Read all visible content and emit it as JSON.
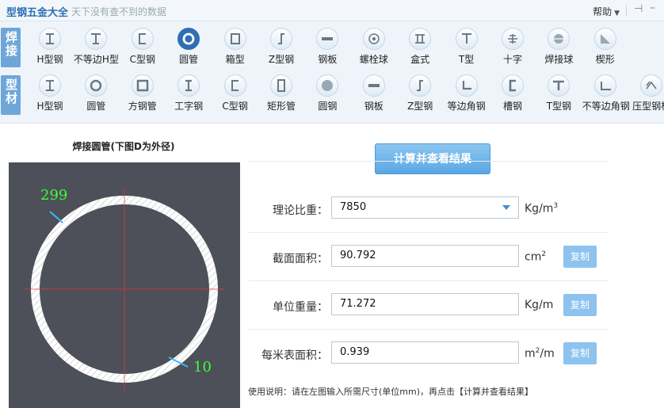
{
  "app": {
    "title": "型钢五金大全",
    "subtitle": "天下没有查不到的数据",
    "help_label": "帮助"
  },
  "row_labels": {
    "welded": "焊接",
    "profile": "型材"
  },
  "welded_tools": [
    {
      "label": "H型钢",
      "icon": "h-beam-icon"
    },
    {
      "label": "不等边H型",
      "icon": "unequal-h-beam-icon"
    },
    {
      "label": "C型钢",
      "icon": "c-channel-icon"
    },
    {
      "label": "圆管",
      "icon": "round-tube-icon"
    },
    {
      "label": "箱型",
      "icon": "box-section-icon"
    },
    {
      "label": "Z型钢",
      "icon": "z-section-icon"
    },
    {
      "label": "钢板",
      "icon": "steel-plate-icon"
    },
    {
      "label": "螺栓球",
      "icon": "bolt-ball-icon"
    },
    {
      "label": "盒式",
      "icon": "box-type-icon"
    },
    {
      "label": "T型",
      "icon": "t-section-icon"
    },
    {
      "label": "十字",
      "icon": "cross-section-icon"
    },
    {
      "label": "焊接球",
      "icon": "welded-ball-icon"
    },
    {
      "label": "楔形",
      "icon": "wedge-icon"
    }
  ],
  "profile_tools": [
    {
      "label": "H型钢",
      "icon": "h-beam-icon"
    },
    {
      "label": "圆管",
      "icon": "round-tube-icon"
    },
    {
      "label": "方钢管",
      "icon": "square-tube-icon"
    },
    {
      "label": "工字钢",
      "icon": "i-beam-icon"
    },
    {
      "label": "C型钢",
      "icon": "c-channel-icon"
    },
    {
      "label": "矩形管",
      "icon": "rect-tube-icon"
    },
    {
      "label": "圆钢",
      "icon": "round-bar-icon"
    },
    {
      "label": "钢板",
      "icon": "steel-plate-icon"
    },
    {
      "label": "Z型钢",
      "icon": "z-section-icon"
    },
    {
      "label": "等边角钢",
      "icon": "equal-angle-icon"
    },
    {
      "label": "槽钢",
      "icon": "channel-icon"
    },
    {
      "label": "T型钢",
      "icon": "t-beam-icon"
    },
    {
      "label": "不等边角钢",
      "icon": "unequal-angle-icon"
    },
    {
      "label": "压型钢板",
      "icon": "corrugated-plate-icon"
    }
  ],
  "left_panel": {
    "title": "焊接圆管(下图D为外径)",
    "outer_diameter": "299",
    "wall_thickness": "10"
  },
  "calc_button": "计算并查看结果",
  "fields": {
    "density": {
      "label": "理论比重：",
      "value": "7850",
      "unit_base": "Kg/m",
      "unit_sup": "3"
    },
    "area": {
      "label": "截面面积：",
      "value": "90.792",
      "unit_base": "cm",
      "unit_sup": "2"
    },
    "weight": {
      "label": "单位重量：",
      "value": "71.272",
      "unit_base": "Kg/m",
      "unit_sup": ""
    },
    "surface": {
      "label": "每米表面积：",
      "value": "0.939",
      "unit_pre": "m",
      "unit_sup": "2",
      "unit_post": "/m"
    }
  },
  "copy_label": "复制",
  "usage": "使用说明：请在左图输入所需尺寸(单位mm)，再点击【计算并查看结果】",
  "colors": {
    "accent": "#2f6fb5",
    "button": "#5aa7e4",
    "copy": "#8dc3ee",
    "drawing_bg": "#4d5058",
    "dim_text": "#3cff3c"
  }
}
